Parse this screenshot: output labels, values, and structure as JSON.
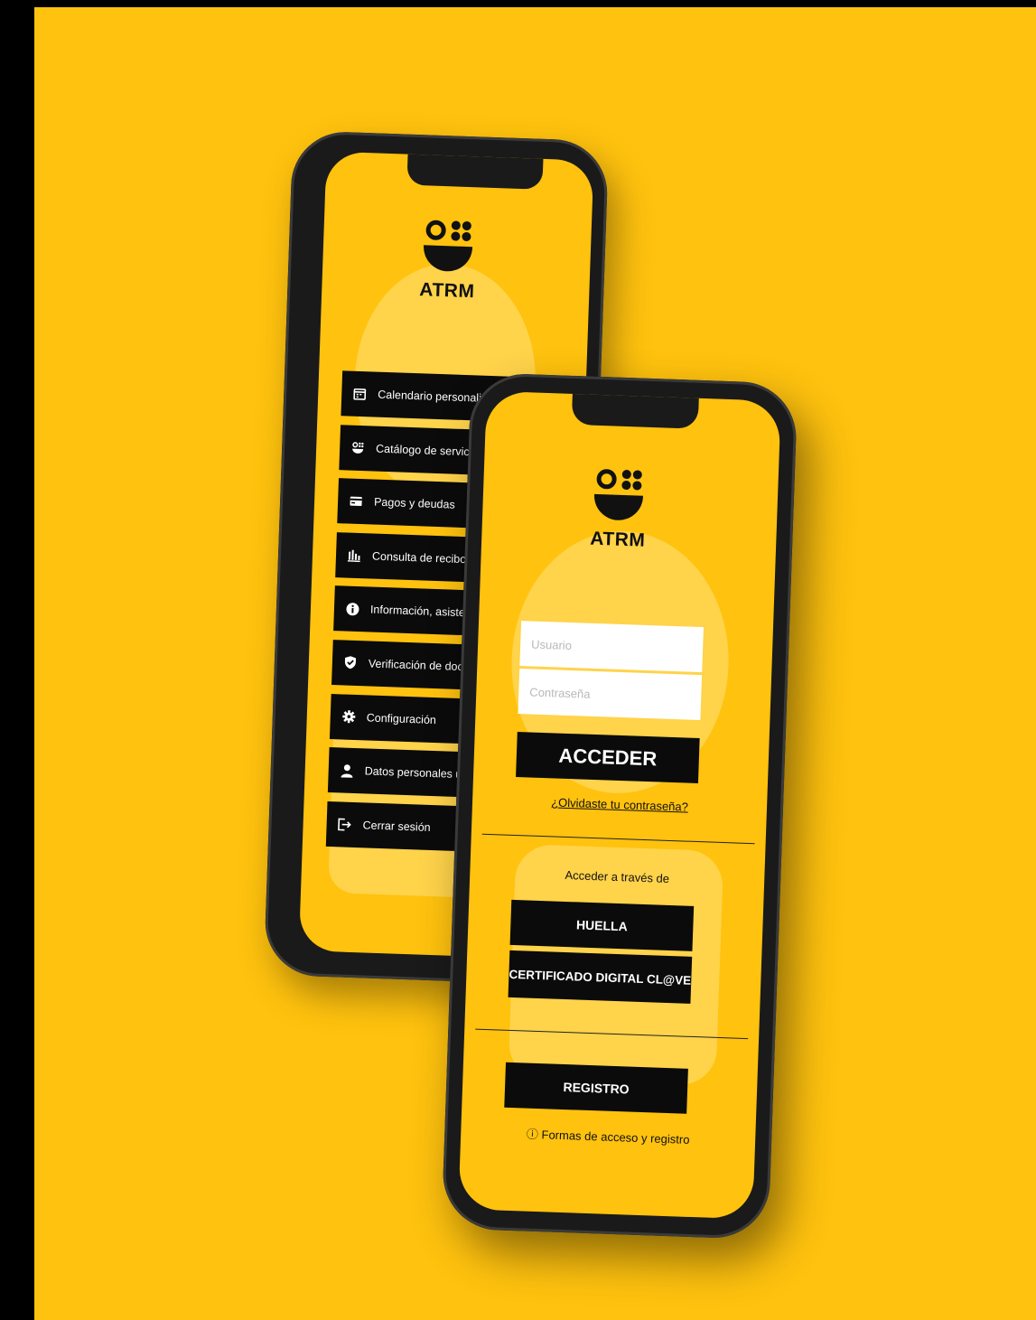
{
  "colors": {
    "brand_yellow": "#FFC20E",
    "black": "#0b0b0b",
    "white": "#ffffff"
  },
  "back_phone": {
    "logo_text": "ATRM",
    "menu": [
      {
        "icon": "calendar-icon",
        "label": "Calendario personalizado fiscal"
      },
      {
        "icon": "catalog-logo-icon",
        "label": "Catálogo de servicios"
      },
      {
        "icon": "credit-card-icon",
        "label": "Pagos y deudas"
      },
      {
        "icon": "bar-chart-icon",
        "label": "Consulta de recibos"
      },
      {
        "icon": "info-icon",
        "label": "Información, asistencia"
      },
      {
        "icon": "shield-check-icon",
        "label": "Verificación de documentos"
      },
      {
        "icon": "gear-icon",
        "label": "Configuración"
      },
      {
        "icon": "user-icon",
        "label": "Datos personales usuario"
      },
      {
        "icon": "logout-icon",
        "label": "Cerrar sesión"
      }
    ]
  },
  "front_phone": {
    "logo_text": "ATRM",
    "username_placeholder": "Usuario",
    "password_placeholder": "Contraseña",
    "login_button": "ACCEDER",
    "forgot_link": "¿Olvidaste tu contraseña?",
    "access_via_label": "Acceder a través de",
    "fingerprint_button": "HUELLA",
    "certificate_button": "CERTIFICADO DIGITAL CL@VE",
    "register_button": "REGISTRO",
    "access_info_link": "ⓘ Formas de acceso y registro"
  }
}
